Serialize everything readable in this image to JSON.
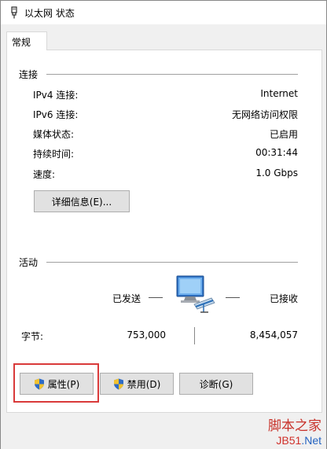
{
  "window": {
    "title": "以太网 状态"
  },
  "tabs": [
    {
      "label": "常规"
    }
  ],
  "connection": {
    "section_title": "连接",
    "rows": [
      {
        "label": "IPv4 连接:",
        "value": "Internet"
      },
      {
        "label": "IPv6 连接:",
        "value": "无网络访问权限"
      },
      {
        "label": "媒体状态:",
        "value": "已启用"
      },
      {
        "label": "持续时间:",
        "value": "00:31:44"
      },
      {
        "label": "速度:",
        "value": "1.0 Gbps"
      }
    ],
    "details_button": "详细信息(E)..."
  },
  "activity": {
    "section_title": "活动",
    "sent_label": "已发送",
    "received_label": "已接收",
    "bytes_label": "字节:",
    "bytes_sent": "753,000",
    "bytes_received": "8,454,057"
  },
  "buttons": {
    "properties": "属性(P)",
    "disable": "禁用(D)",
    "diagnose": "诊断(G)"
  },
  "watermark": {
    "top": "脚本之家",
    "bottom_a": "JB51",
    "bottom_b": ".Net"
  },
  "icons": {
    "title": "ethernet-plug-icon",
    "network": "network-computer-icon",
    "shield": "uac-shield-icon"
  },
  "colors": {
    "highlight": "#d93a3a",
    "button_bg": "#e1e1e1"
  }
}
